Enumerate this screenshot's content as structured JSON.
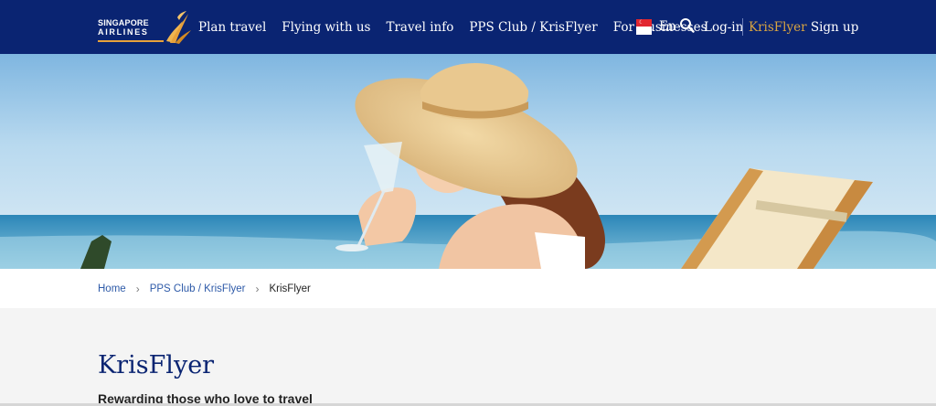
{
  "brand": {
    "logo_line1": "SINGAPORE",
    "logo_line2": "AIRLINES",
    "colors": {
      "header_bg": "#0a2472",
      "gold": "#d9a441",
      "title_blue": "#0a2472",
      "link_blue": "#2e5aa8"
    }
  },
  "nav": {
    "items": [
      {
        "label": "Plan travel"
      },
      {
        "label": "Flying with us"
      },
      {
        "label": "Travel info"
      },
      {
        "label": "PPS Club / KrisFlyer"
      },
      {
        "label": "For Businesses"
      }
    ]
  },
  "utility": {
    "flag_icon": "singapore-flag-icon",
    "language": "En",
    "search_icon": "search-icon",
    "login_label": "Log-in",
    "signup_brand": "KrisFlyer",
    "signup_label": "Sign up"
  },
  "breadcrumb": {
    "items": [
      {
        "label": "Home"
      },
      {
        "label": "PPS Club / KrisFlyer"
      }
    ],
    "separator": "›",
    "current": "KrisFlyer"
  },
  "main": {
    "title": "KrisFlyer",
    "subtitle": "Rewarding those who love to travel"
  }
}
